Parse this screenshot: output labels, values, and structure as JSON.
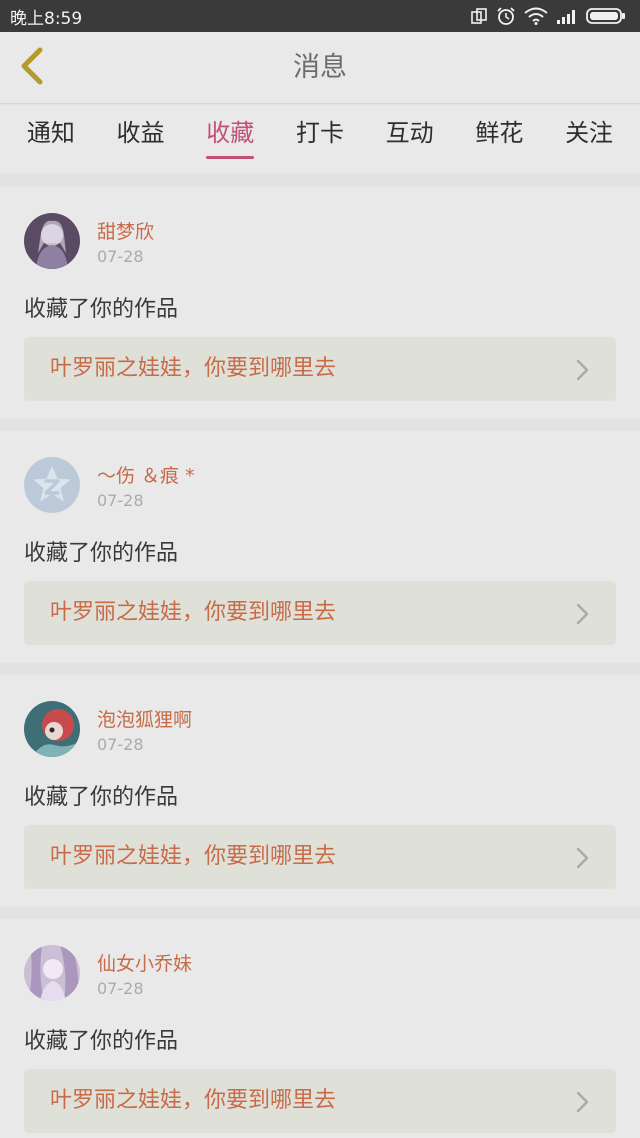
{
  "status_bar": {
    "time": "晚上8:59",
    "icons": [
      "rotate-lock-icon",
      "alarm-icon",
      "wifi-icon",
      "signal-icon",
      "battery-icon"
    ]
  },
  "header": {
    "back_icon": "chevron-left-icon",
    "title": "消息"
  },
  "tabs": [
    {
      "label": "通知",
      "active": false
    },
    {
      "label": "收益",
      "active": false
    },
    {
      "label": "收藏",
      "active": true
    },
    {
      "label": "打卡",
      "active": false
    },
    {
      "label": "互动",
      "active": false
    },
    {
      "label": "鲜花",
      "active": false
    },
    {
      "label": "关注",
      "active": false
    }
  ],
  "items": [
    {
      "username": "甜梦欣",
      "date": "07-28",
      "action": "收藏了你的作品",
      "work_title": "叶罗丽之娃娃，你要到哪里去"
    },
    {
      "username": "～伤 ＆痕 *",
      "date": "07-28",
      "action": "收藏了你的作品",
      "work_title": "叶罗丽之娃娃，你要到哪里去"
    },
    {
      "username": "泡泡狐狸啊",
      "date": "07-28",
      "action": "收藏了你的作品",
      "work_title": "叶罗丽之娃娃，你要到哪里去"
    },
    {
      "username": "仙女小乔妹",
      "date": "07-28",
      "action": "收藏了你的作品",
      "work_title": "叶罗丽之娃娃，你要到哪里去"
    }
  ],
  "colors": {
    "accent": "#c2507a",
    "username": "#c86b49",
    "work_title": "#c86b49",
    "back_chevron": "#b59a2a"
  }
}
